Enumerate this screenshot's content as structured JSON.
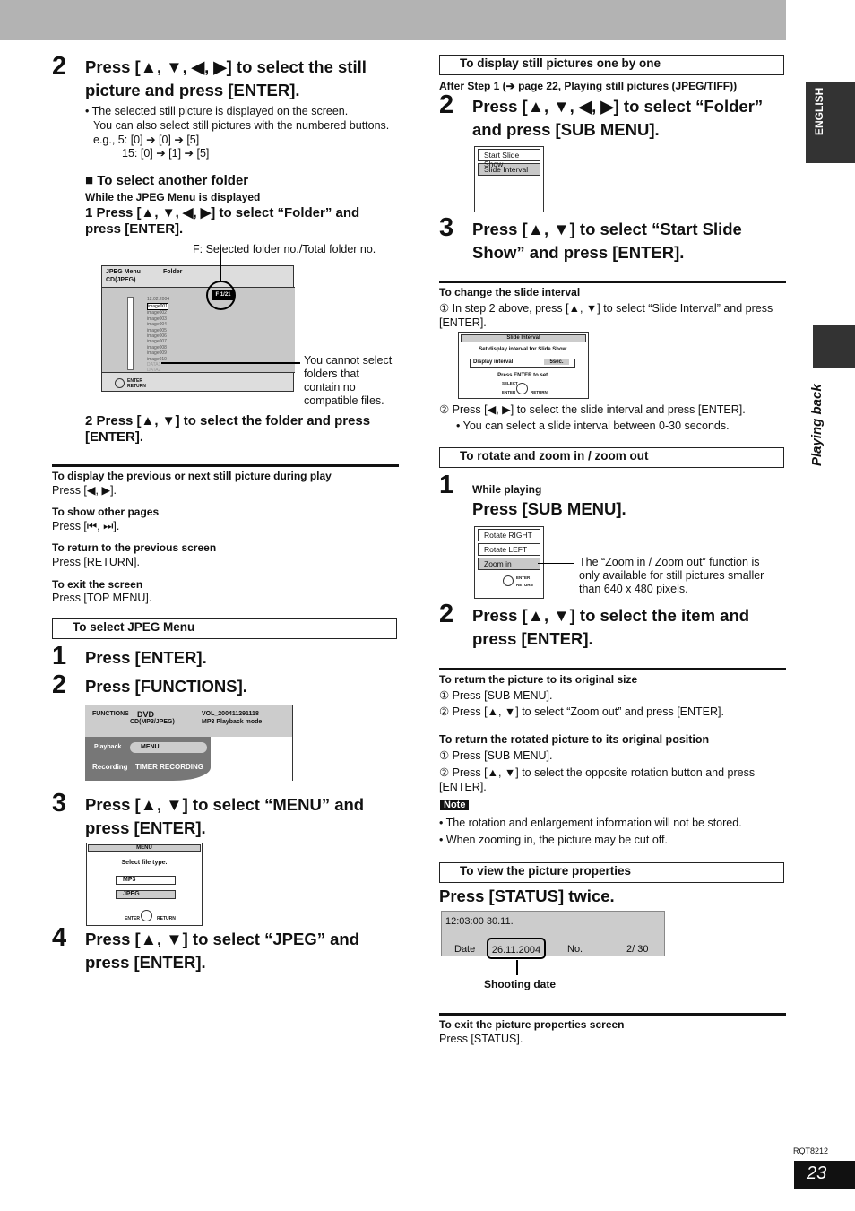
{
  "left": {
    "step2": {
      "num": "2",
      "title": "Press [▲, ▼, ◀, ▶] to select the still picture and press [ENTER].",
      "bullet": "The selected still picture is displayed on the screen.",
      "line2": "You can also select still pictures with the numbered buttons.",
      "eg1": "e.g.,  5:    [0] ➔ [0]  ➔ [5]",
      "eg2": "15:  [0] ➔ [1]  ➔ [5]"
    },
    "folder": {
      "heading": "■ To select another folder",
      "sub": "While the JPEG Menu is displayed",
      "s1": "1  Press [▲, ▼, ◀, ▶] to select “Folder” and press [ENTER].",
      "callout_f": "F: Selected folder no./Total folder no.",
      "screen": {
        "title": "JPEG Menu",
        "tab": "Folder",
        "disc": "CD(JPEG)",
        "date": "12.02.2004",
        "counter": "F  1/21",
        "items": [
          "image001",
          "image002",
          "image003",
          "image004",
          "image005",
          "image006",
          "image007",
          "image008",
          "image009",
          "image010",
          "DATA1",
          "DATA2"
        ],
        "enter": "ENTER",
        "return": "RETURN"
      },
      "callout_no": "You cannot select folders that contain no compatible files.",
      "s2": "2  Press [▲, ▼] to select the folder and press [ENTER]."
    },
    "tips": [
      {
        "h": "To display the previous or next still picture during play",
        "t": "Press [◀, ▶]."
      },
      {
        "h": "To show other pages",
        "t": "Press [⏮, ⏭]."
      },
      {
        "h": "To return to the previous screen",
        "t": "Press [RETURN]."
      },
      {
        "h": "To exit the screen",
        "t": "Press [TOP MENU]."
      }
    ],
    "jpeg_menu": {
      "box": "To select JPEG Menu",
      "s1n": "1",
      "s1": "Press [ENTER].",
      "s2n": "2",
      "s2": "Press [FUNCTIONS].",
      "func": {
        "label": "FUNCTIONS",
        "dvd": "DVD",
        "disc": "CD(MP3/JPEG)",
        "vol": "VOL_200411291118",
        "mode": "MP3 Playback mode",
        "playback": "Playback",
        "menu": "MENU",
        "recording": "Recording",
        "timer": "TIMER RECORDING"
      },
      "s3n": "3",
      "s3": "Press [▲, ▼] to select “MENU” and press [ENTER].",
      "menu": {
        "title": "MENU",
        "prompt": "Select file type.",
        "opt1": "MP3",
        "opt2": "JPEG",
        "enter": "ENTER",
        "return": "RETURN"
      },
      "s4n": "4",
      "s4": "Press [▲, ▼] to select “JPEG” and press [ENTER]."
    }
  },
  "right": {
    "one": {
      "box": "To display still pictures one by one",
      "after": "After Step 1 (➔ page 22, Playing still pictures (JPEG/TIFF))",
      "s2n": "2",
      "s2": "Press [▲, ▼, ◀, ▶] to select “Folder” and press [SUB MENU].",
      "menu": [
        "Start Slide Show",
        "Slide Interval"
      ],
      "s3n": "3",
      "s3": "Press [▲, ▼] to select “Start Slide Show” and press [ENTER]."
    },
    "interval": {
      "h": "To change the slide interval",
      "i1": "① In step 2 above, press [▲, ▼] to select “Slide Interval” and press [ENTER].",
      "scr": {
        "title": "Slide Interval",
        "prompt": "Set display interval for Slide Show.",
        "label": "Display interval",
        "value": "5sec.",
        "press": "Press ENTER to set.",
        "select": "SELECT",
        "enter": "ENTER",
        "return": "RETURN"
      },
      "i2": "② Press [◀, ▶] to select the slide interval and press [ENTER].",
      "b": "You can select a slide interval between 0-30 seconds."
    },
    "rotate": {
      "box": "To rotate and zoom in / zoom out",
      "s1n": "1",
      "while": "While playing",
      "s1": "Press [SUB MENU].",
      "menu": [
        "Rotate RIGHT",
        "Rotate LEFT",
        "Zoom in"
      ],
      "enter": "ENTER",
      "return": "RETURN",
      "callout": "The “Zoom in / Zoom out” function is only available for still pictures smaller than 640 x 480 pixels.",
      "s2n": "2",
      "s2": "Press [▲, ▼] to select the item and press [ENTER]."
    },
    "orig": {
      "h": "To return the picture to its original size",
      "i1": "① Press [SUB MENU].",
      "i2": "② Press [▲, ▼] to select “Zoom out” and press [ENTER]."
    },
    "rot": {
      "h": "To return the rotated picture to its original position",
      "i1": "① Press [SUB MENU].",
      "i2": "② Press [▲, ▼] to select the opposite rotation button and press [ENTER]."
    },
    "note": {
      "label": "Note",
      "b1": "The rotation and enlargement information will not be stored.",
      "b2": "When zooming in, the picture may be cut off."
    },
    "props": {
      "box": "To view the picture properties",
      "title": "Press [STATUS] twice.",
      "time": "12:03:00  30.11.",
      "date_label": "Date",
      "date": "26.11.2004",
      "no_label": "No.",
      "no": "2/  30",
      "callout": "Shooting date"
    },
    "exit": {
      "h": "To exit the picture properties screen",
      "t": "Press [STATUS]."
    }
  },
  "side": {
    "lang": "ENGLISH",
    "section": "Playing back"
  },
  "footer": {
    "code": "RQT8212",
    "page": "23"
  }
}
